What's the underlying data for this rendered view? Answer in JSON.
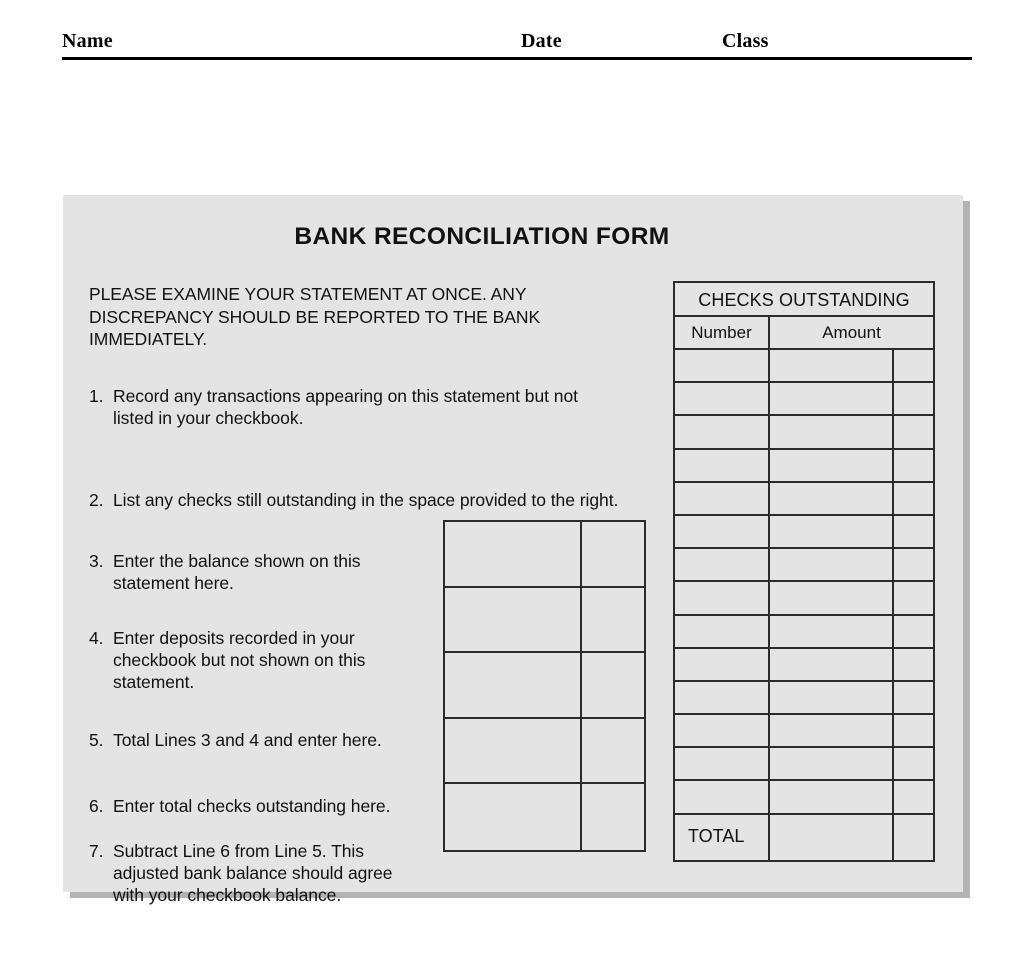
{
  "header": {
    "name_label": "Name",
    "date_label": "Date",
    "class_label": "Class"
  },
  "form": {
    "title": "BANK RECONCILIATION FORM",
    "notice": {
      "line1": "PLEASE EXAMINE YOUR STATEMENT AT ONCE. ANY",
      "line2": "DISCREPANCY SHOULD BE REPORTED TO THE BANK",
      "line3": "IMMEDIATELY."
    },
    "steps": [
      {
        "number": "1.",
        "lines": [
          "Record any transactions appearing on this statement but not",
          "listed in your checkbook."
        ]
      },
      {
        "number": "2.",
        "lines": [
          "List any checks still outstanding in the space provided to the right."
        ]
      },
      {
        "number": "3.",
        "lines": [
          "Enter the balance shown on this",
          "statement here."
        ]
      },
      {
        "number": "4.",
        "lines": [
          "Enter deposits recorded in your",
          "checkbook but not shown on this",
          "statement."
        ]
      },
      {
        "number": "5.",
        "lines": [
          "Total Lines 3 and 4 and enter here."
        ]
      },
      {
        "number": "6.",
        "lines": [
          "Enter total checks outstanding here."
        ]
      },
      {
        "number": "7.",
        "lines": [
          "Subtract Line 6 from Line 5. This",
          "adjusted bank balance should agree",
          "with your checkbook balance."
        ]
      }
    ],
    "amount_boxes": {
      "row_count": 5,
      "dollars_values": [
        "",
        "",
        "",
        "",
        ""
      ],
      "cents_values": [
        "",
        "",
        "",
        "",
        ""
      ]
    }
  },
  "checks_outstanding": {
    "title": "CHECKS OUTSTANDING",
    "columns": [
      "Number",
      "Amount"
    ],
    "rows": [
      {
        "number": "",
        "amount": "",
        "cents": ""
      },
      {
        "number": "",
        "amount": "",
        "cents": ""
      },
      {
        "number": "",
        "amount": "",
        "cents": ""
      },
      {
        "number": "",
        "amount": "",
        "cents": ""
      },
      {
        "number": "",
        "amount": "",
        "cents": ""
      },
      {
        "number": "",
        "amount": "",
        "cents": ""
      },
      {
        "number": "",
        "amount": "",
        "cents": ""
      },
      {
        "number": "",
        "amount": "",
        "cents": ""
      },
      {
        "number": "",
        "amount": "",
        "cents": ""
      },
      {
        "number": "",
        "amount": "",
        "cents": ""
      },
      {
        "number": "",
        "amount": "",
        "cents": ""
      },
      {
        "number": "",
        "amount": "",
        "cents": ""
      },
      {
        "number": "",
        "amount": "",
        "cents": ""
      },
      {
        "number": "",
        "amount": "",
        "cents": ""
      }
    ],
    "total_label": "TOTAL",
    "total_amount": "",
    "total_cents": ""
  },
  "colors": {
    "page_background": "#ffffff",
    "card_background": "#e4e4e4",
    "card_shadow": "#b3b3b3",
    "rule": "#000000",
    "border": "#2b2b2b",
    "text": "#111111"
  }
}
